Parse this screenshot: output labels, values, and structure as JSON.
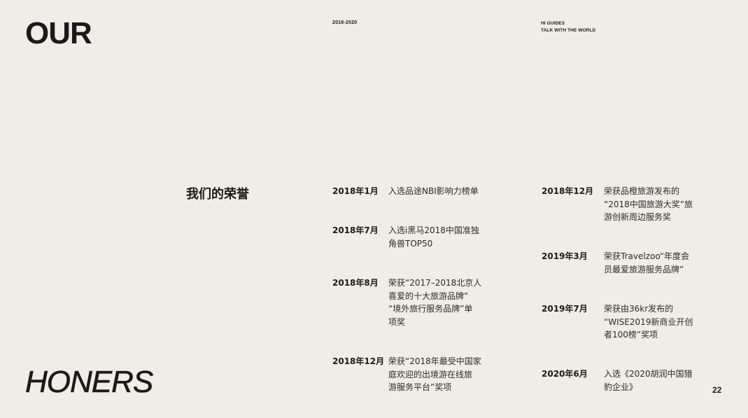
{
  "header": {
    "title_top": "OUR",
    "title_bottom": "HONERS",
    "years": "2018-2020",
    "brand_line1": "HI GUIDES",
    "brand_line2": "TALK WITH THE WORLD"
  },
  "section_title": "我们的荣誉",
  "column1": [
    {
      "date": "2018年1月",
      "lines": [
        "入选品途NBI影响力榜单"
      ]
    },
    {
      "date": "2018年7月",
      "lines": [
        "入选i黑马2018中国准独",
        "角兽TOP50"
      ]
    },
    {
      "date": "2018年8月",
      "lines": [
        "荣获“2017–2018北京人",
        "喜爱的十大旅游品牌”",
        "“境外旅行服务品牌”单",
        "项奖"
      ]
    },
    {
      "date": "2018年12月",
      "lines": [
        "荣获“2018年最受中国家",
        "庭欢迎的出境游在线旅",
        "游服务平台”奖项"
      ]
    }
  ],
  "column2": [
    {
      "date": "2018年12月",
      "lines": [
        "荣获品橙旅游发布的",
        "“2018中国旅游大奖”旅",
        "游创新周边服务奖"
      ]
    },
    {
      "date": "2019年3月",
      "lines": [
        "荣获Travelzoo“年度会",
        "员最爱旅游服务品牌”"
      ]
    },
    {
      "date": "2019年7月",
      "lines": [
        "荣获由36kr发布的",
        "“WISE2019新商业开创",
        "者100榜”奖项"
      ]
    },
    {
      "date": "2020年6月",
      "lines": [
        "入选《2020胡润中国猎",
        "豹企业》"
      ]
    }
  ],
  "page_number": "22"
}
